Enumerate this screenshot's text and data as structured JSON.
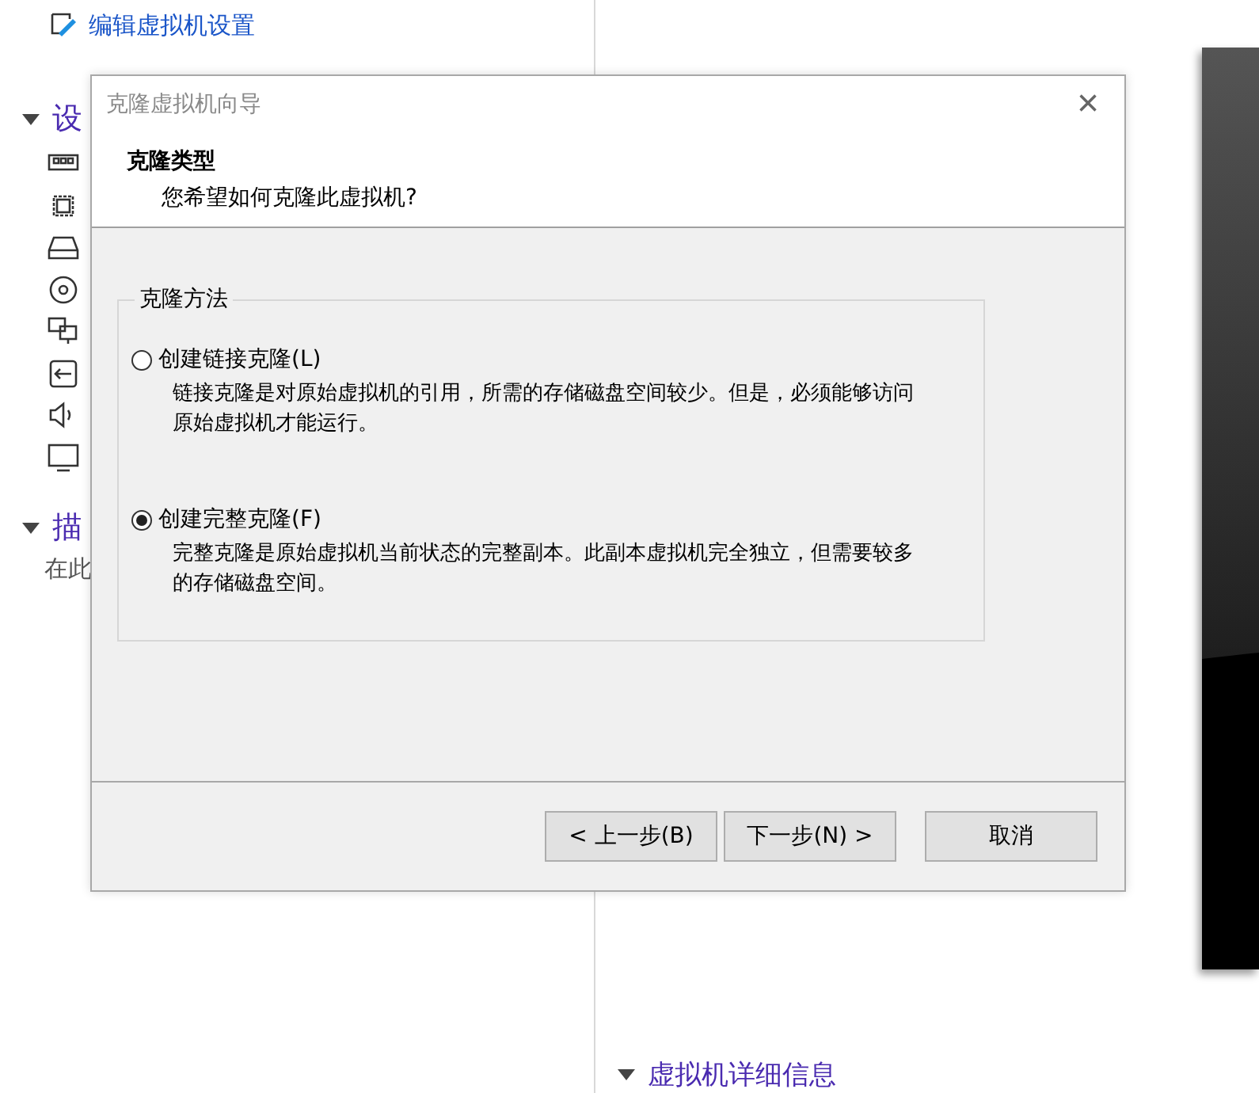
{
  "background": {
    "commands": [
      {
        "label": "编辑虚拟机设置"
      }
    ],
    "sections": [
      {
        "title": "设",
        "expanded": true,
        "devices": [
          {
            "kind": "memory"
          },
          {
            "kind": "cpu"
          },
          {
            "kind": "disk"
          },
          {
            "kind": "cd"
          },
          {
            "kind": "network"
          },
          {
            "kind": "usb"
          },
          {
            "kind": "sound"
          },
          {
            "kind": "display"
          }
        ]
      },
      {
        "title": "描",
        "expanded": true,
        "text": "在此"
      }
    ],
    "details": {
      "title": "虚拟机详细信息",
      "expanded": true
    }
  },
  "dialog": {
    "title": "克隆虚拟机向导",
    "close": "×",
    "heading": "克隆类型",
    "subheading": "您希望如何克隆此虚拟机?",
    "group": "克隆方法",
    "options": [
      {
        "label": "创建链接克隆(L)",
        "description": "链接克隆是对原始虚拟机的引用，所需的存储磁盘空间较少。但是，必须能够访问原始虚拟机才能运行。",
        "selected": false
      },
      {
        "label": "创建完整克隆(F)",
        "description": "完整克隆是原始虚拟机当前状态的完整副本。此副本虚拟机完全独立，但需要较多的存储磁盘空间。",
        "selected": true
      }
    ],
    "buttons": [
      {
        "label": "< 上一步(B)"
      },
      {
        "label": "下一步(N) >"
      },
      {
        "label": "取消"
      }
    ]
  }
}
